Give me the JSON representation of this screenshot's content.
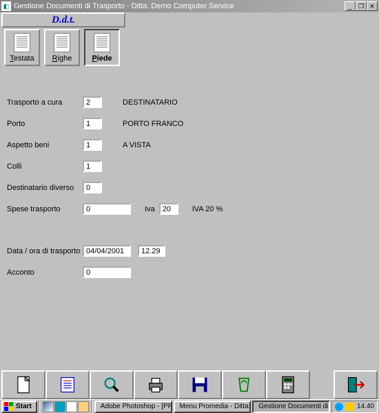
{
  "window": {
    "title": "Gestione Documenti di Trasporto - Ditta: Demo Computer Service"
  },
  "header": {
    "title": "D.d.t."
  },
  "tabs": {
    "testata": "Testata",
    "righe": "Righe",
    "piede": "Piede",
    "active": "piede"
  },
  "form": {
    "trasporto_label": "Trasporto a cura",
    "trasporto_value": "2",
    "trasporto_desc": "DESTINATARIO",
    "porto_label": "Porto",
    "porto_value": "1",
    "porto_desc": "PORTO FRANCO",
    "aspetto_label": "Aspetto beni",
    "aspetto_value": "1",
    "aspetto_desc": "A VISTA",
    "colli_label": "Colli",
    "colli_value": "1",
    "destdiv_label": "Destinatario diverso",
    "destdiv_value": "0",
    "spese_label": "Spese trasporto",
    "spese_value": "0",
    "iva_label": "Iva",
    "iva_value": "20",
    "iva_desc": "IVA 20 %",
    "dataora_label": "Data / ora di trasporto",
    "data_value": "04/04/2001",
    "ora_value": "12.29",
    "acconto_label": "Acconto",
    "acconto_value": "0"
  },
  "taskbar": {
    "start": "Start",
    "items": [
      "Adobe Photoshop - [PRIM...",
      "Menu Promedia - Ditta: De...",
      "Gestione Documenti di Tra..."
    ],
    "clock": "14.40"
  }
}
